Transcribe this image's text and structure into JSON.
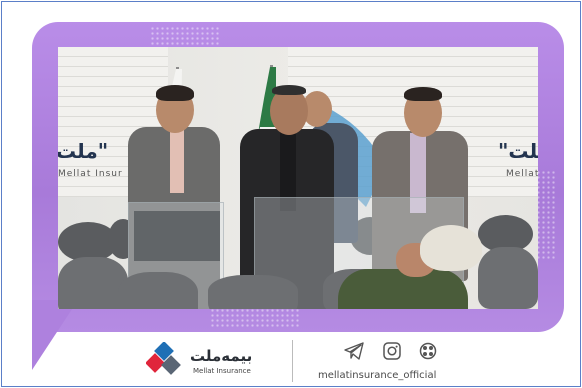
{
  "photo": {
    "wall_text_left": "ملت\"",
    "wall_text_left_sub": "Mellat Insur",
    "wall_text_right": "\"ملت",
    "wall_text_right_sub": "Mellat"
  },
  "footer": {
    "brand_name": "بیمه‌ملت",
    "brand_sub": "Mellat Insurance",
    "social_icons": [
      "telegram-icon",
      "instagram-icon",
      "aparat-icon"
    ],
    "handle": "mellatinsurance_official"
  },
  "colors": {
    "frame": "#b286e2",
    "logo_red": "#e0253b",
    "logo_blue": "#1f6fb5",
    "logo_grey": "#5a6675"
  }
}
